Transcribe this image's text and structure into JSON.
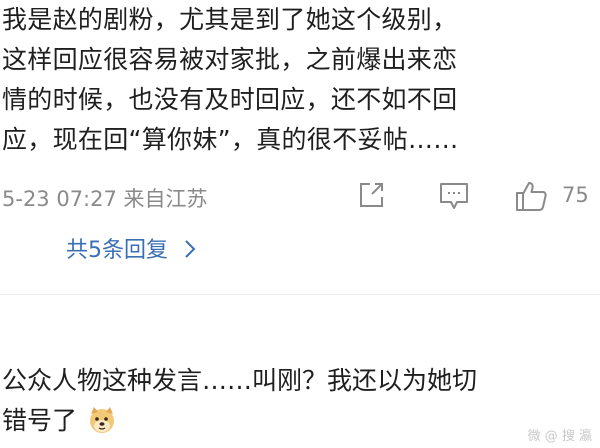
{
  "comment1": {
    "lines": [
      "我是赵的剧粉，尤其是到了她这个级别，",
      "这样回应很容易被对家批，之前爆出来恋",
      "情的时候，也没有及时回应，还不如不回",
      "应，现在回“算你妹”，真的很不妥帖……"
    ]
  },
  "meta": {
    "date_source": "5-23 07:27  来自江苏",
    "likes": "75",
    "icons": [
      "share-icon",
      "reply-icon",
      "like-icon"
    ]
  },
  "replies_link": "共5条回复",
  "comment2": {
    "line1": "公众人物这种发言……叫刚？我还以为她切",
    "line2": "错号了"
  },
  "watermark": "微 @ 搜 瀛"
}
